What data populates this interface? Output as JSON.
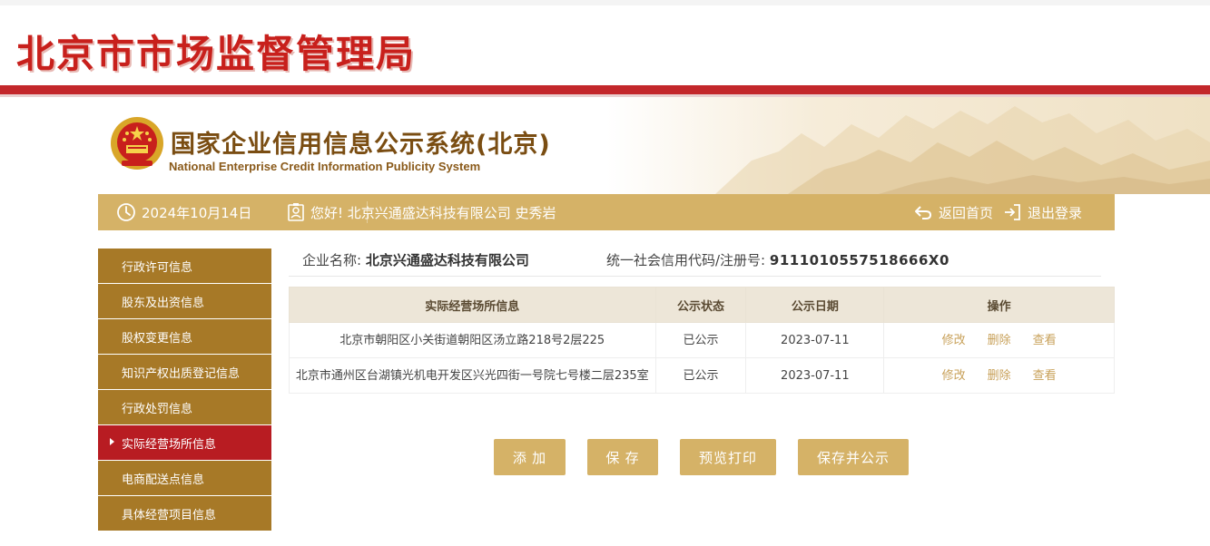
{
  "authority": {
    "title": "北京市市场监督管理局"
  },
  "system": {
    "title_cn": "国家企业信用信息公示系统(北京)",
    "title_en": "National Enterprise Credit Information Publicity System"
  },
  "info_bar": {
    "date": "2024年10月14日",
    "greeting": "您好!  北京兴通盛达科技有限公司  史秀岩",
    "home_link": "返回首页",
    "logout_link": "退出登录"
  },
  "sidebar": {
    "items": [
      {
        "label": "行政许可信息",
        "active": false
      },
      {
        "label": "股东及出资信息",
        "active": false
      },
      {
        "label": "股权变更信息",
        "active": false
      },
      {
        "label": "知识产权出质登记信息",
        "active": false
      },
      {
        "label": "行政处罚信息",
        "active": false
      },
      {
        "label": "实际经营场所信息",
        "active": true
      },
      {
        "label": "电商配送点信息",
        "active": false
      },
      {
        "label": "具体经营项目信息",
        "active": false
      }
    ]
  },
  "company": {
    "name_label": "企业名称:",
    "name_value": "北京兴通盛达科技有限公司",
    "code_label": "统一社会信用代码/注册号:",
    "code_value": "9111010557518666X0"
  },
  "table": {
    "headers": [
      "实际经营场所信息",
      "公示状态",
      "公示日期",
      "操作"
    ],
    "rows": [
      {
        "address": "北京市朝阳区小关街道朝阳区汤立路218号2层225",
        "status": "已公示",
        "date": "2023-07-11",
        "ops": [
          "修改",
          "删除",
          "查看"
        ]
      },
      {
        "address": "北京市通州区台湖镇光机电开发区兴光四街一号院七号楼二层235室",
        "status": "已公示",
        "date": "2023-07-11",
        "ops": [
          "修改",
          "删除",
          "查看"
        ]
      }
    ]
  },
  "buttons": {
    "add": "添 加",
    "save": "保 存",
    "preview_print": "预览打印",
    "save_publish": "保存并公示"
  },
  "colors": {
    "brand_red": "#c3272b",
    "gold": "#d5b267",
    "sidebar_brown": "#a77927",
    "active_red": "#b81c22"
  },
  "icons": {
    "date": "clock-icon",
    "user": "user-badge-icon",
    "home": "return-arrow-icon",
    "logout": "logout-icon",
    "emblem": "national-emblem-icon"
  }
}
